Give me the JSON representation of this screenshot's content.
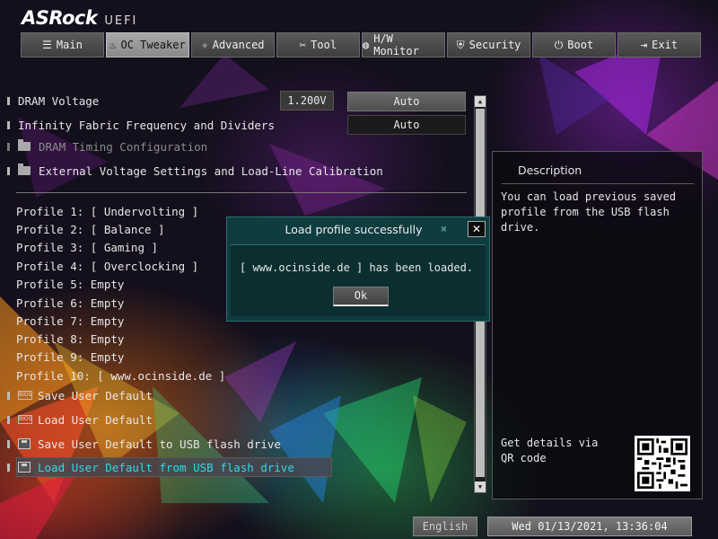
{
  "brand": {
    "logo": "ASRock",
    "suffix": "UEFI"
  },
  "tabs": [
    {
      "label": "Main",
      "icon": "list-icon"
    },
    {
      "label": "OC Tweaker",
      "icon": "flame-icon",
      "active": true
    },
    {
      "label": "Advanced",
      "icon": "star-icon"
    },
    {
      "label": "Tool",
      "icon": "tools-icon"
    },
    {
      "label": "H/W Monitor",
      "icon": "globe-icon"
    },
    {
      "label": "Security",
      "icon": "shield-icon"
    },
    {
      "label": "Boot",
      "icon": "power-icon"
    },
    {
      "label": "Exit",
      "icon": "exit-icon"
    }
  ],
  "settings": {
    "dram_voltage": {
      "label": "DRAM Voltage",
      "value": "1.200V",
      "mode": "Auto"
    },
    "infinity_fabric": {
      "label": "Infinity Fabric Frequency and Dividers",
      "mode": "Auto"
    },
    "dram_timing": {
      "label": "DRAM Timing Configuration"
    },
    "external_voltage": {
      "label": "External Voltage Settings and Load-Line Calibration"
    }
  },
  "profiles": [
    "Profile 1: [ Undervolting ]",
    "Profile 2: [ Balance ]",
    "Profile 3: [ Gaming ]",
    "Profile 4: [ Overclocking ]",
    "Profile 5: Empty",
    "Profile 6: Empty",
    "Profile 7: Empty",
    "Profile 8: Empty",
    "Profile 9: Empty",
    "Profile 10: [ www.ocinside.de ]"
  ],
  "actions": {
    "save_default": "Save User Default",
    "load_default": "Load User Default",
    "save_usb": "Save User Default to USB flash drive",
    "load_usb": "Load User Default from USB flash drive",
    "bios_badge": "BIOS"
  },
  "description": {
    "title": "Description",
    "text": "You can load previous saved profile from the USB flash drive.",
    "qr_label": "Get details via QR code"
  },
  "dialog": {
    "title": "Load profile successfully",
    "message": "[ www.ocinside.de ] has been loaded.",
    "ok_label": "Ok",
    "close_glyph": "✕"
  },
  "footer": {
    "language": "English",
    "datetime": "Wed 01/13/2021, 13:36:04"
  },
  "colors": {
    "selected_text": "#34d7e8",
    "dialog_bg": "#0f3c3f"
  }
}
